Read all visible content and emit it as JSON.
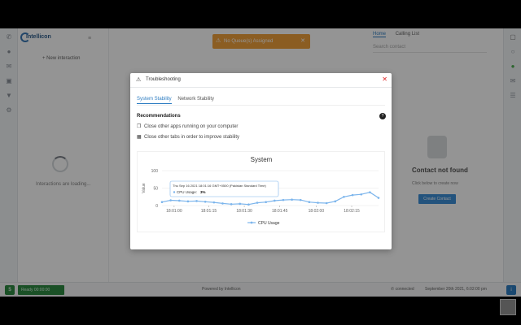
{
  "app": {
    "logo_text": "Intellicon",
    "new_interaction": "+   New interaction",
    "loading_text": "Interactions are loading..."
  },
  "toast": {
    "message": "No Queue(s) Assigned",
    "color": "#f0a03c"
  },
  "right_panel": {
    "tabs": [
      {
        "label": "Home",
        "active": true
      },
      {
        "label": "Calling List",
        "active": false
      }
    ],
    "search_placeholder": "Search contact",
    "contact_not_found": "Contact not found",
    "create_hint": "Click below to create now",
    "create_button": "Create Contact"
  },
  "status_bar": {
    "ready_label": "Ready 00:00:00",
    "powered_by": "Powered by Intellicon",
    "connection": "connected",
    "date_time": "September 20th 2021, 6:02:00 pm"
  },
  "modal": {
    "title": "Troubleshooting",
    "tabs": [
      {
        "label": "System Stability",
        "active": true
      },
      {
        "label": "Network Stability",
        "active": false
      }
    ],
    "recommendations_title": "Recommendations",
    "recommendations": [
      {
        "icon": "window-icon",
        "text": "Close other apps running on your computer"
      },
      {
        "icon": "tabs-icon",
        "text": "Close other tabs in order to improve stability"
      }
    ]
  },
  "chart_data": {
    "type": "line",
    "title": "System",
    "ylabel": "Value",
    "xlabel": "",
    "ylim": [
      0,
      100
    ],
    "yticks": [
      0,
      50,
      100
    ],
    "xticks": [
      "18:01:00",
      "18:01:15",
      "18:01:30",
      "18:01:45",
      "18:02:00",
      "18:02:15"
    ],
    "series": [
      {
        "name": "CPU Usage",
        "color": "#7cb5ec",
        "values": [
          10,
          15,
          14,
          12,
          13,
          11,
          9,
          6,
          4,
          5,
          3,
          8,
          10,
          14,
          16,
          17,
          16,
          10,
          8,
          7,
          12,
          25,
          30,
          32,
          38,
          22
        ]
      }
    ],
    "tooltip": {
      "header": "Thu Sep 16 2021 18:01:16 GMT+0500 (Pakistan Standard Time)",
      "series": "CPU Usage",
      "value": "3%"
    },
    "legend_position": "bottom-center"
  }
}
